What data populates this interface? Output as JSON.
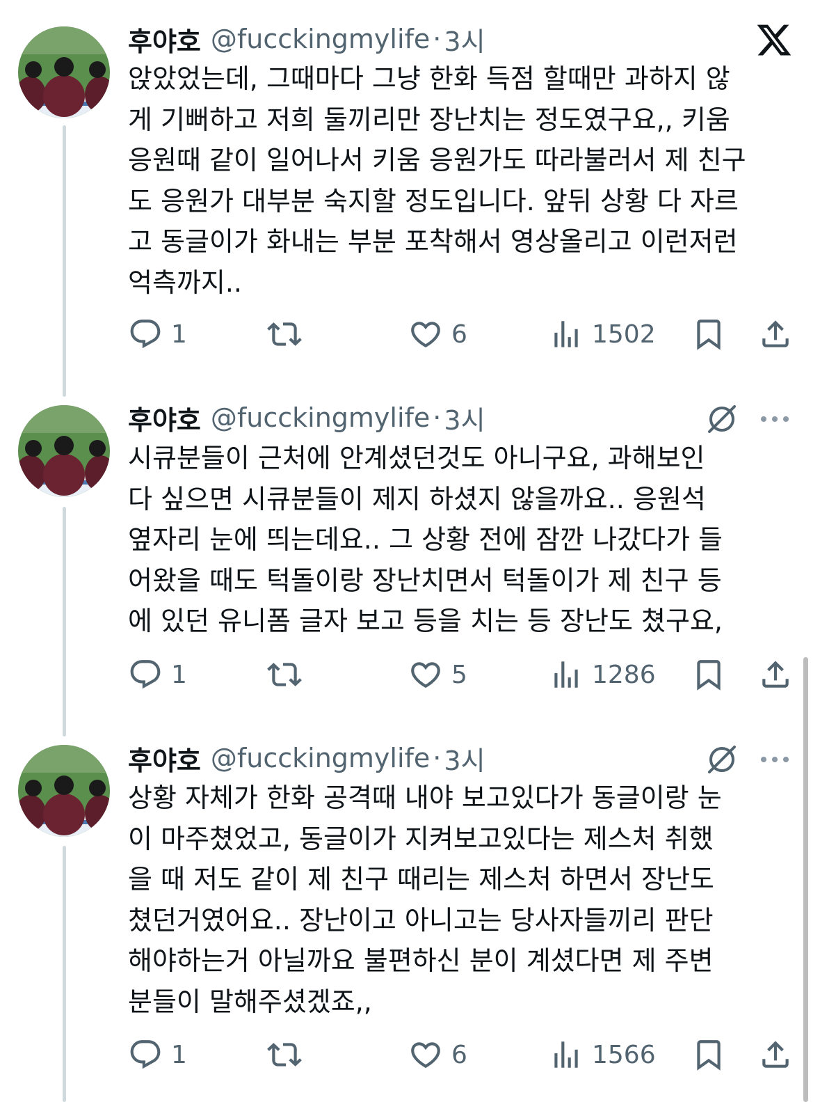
{
  "tweets": [
    {
      "name": "후야호",
      "handle": "@fucckingmylife",
      "separator": "·",
      "time": "3시",
      "lines": [
        "앉았었는데, 그때마다 그냥 한화 득점 할때만 과하지 않",
        "게 기뻐하고 저희 둘끼리만 장난치는 정도였구요,, 키움",
        "응원때 같이 일어나서 키움 응원가도 따라불러서 제 친구",
        "도 응원가 대부분 숙지할 정도입니다. 앞뒤 상황 다 자르",
        "고 동글이가 화내는 부분 포착해서 영상올리고 이런저런",
        "억측까지.."
      ],
      "replies": "1",
      "likes": "6",
      "views": "1502"
    },
    {
      "name": "후야호",
      "handle": "@fucckingmylife",
      "separator": "·",
      "time": "3시",
      "lines": [
        "시큐분들이 근처에 안계셨던것도 아니구요, 과해보인",
        "다 싶으면 시큐분들이 제지 하셨지 않을까요.. 응원석",
        "옆자리 눈에 띄는데요.. 그 상황 전에 잠깐 나갔다가 들",
        "어왔을 때도 턱돌이랑 장난치면서 턱돌이가 제 친구 등",
        "에 있던 유니폼 글자 보고 등을 치는 등 장난도 쳤구요,"
      ],
      "replies": "1",
      "likes": "5",
      "views": "1286"
    },
    {
      "name": "후야호",
      "handle": "@fucckingmylife",
      "separator": "·",
      "time": "3시",
      "lines": [
        "상황 자체가 한화 공격때 내야 보고있다가 동글이랑 눈",
        "이 마주쳤었고, 동글이가 지켜보고있다는 제스처 취했",
        "을 때 저도 같이 제 친구 때리는 제스처 하면서 장난도",
        "쳤던거였어요.. 장난이고 아니고는 당사자들끼리 판단",
        "해야하는거 아닐까요 불편하신 분이 계셨다면 제 주변",
        "분들이 말해주셨겠죠,,"
      ],
      "replies": "1",
      "likes": "6",
      "views": "1566"
    }
  ],
  "icons": {
    "reply": "reply-icon",
    "retweet": "retweet-icon",
    "like": "heart-icon",
    "views": "views-icon",
    "bookmark": "bookmark-icon",
    "share": "share-icon",
    "x_logo": "x-logo-icon",
    "grok": "grok-icon",
    "more": "more-icon"
  },
  "colors": {
    "text": "#0f1419",
    "secondary": "#536471",
    "thread_line": "#cfd9de"
  }
}
